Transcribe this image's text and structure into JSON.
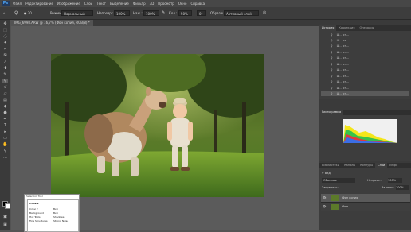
{
  "app": {
    "logo": "Ps"
  },
  "menu": [
    "Файл",
    "Редактирование",
    "Изображение",
    "Слои",
    "Текст",
    "Выделение",
    "Фильтр",
    "3D",
    "Просмотр",
    "Окно",
    "Справка"
  ],
  "options": {
    "mode_label": "Режим:",
    "mode_value": "Нормальный",
    "opacity_label": "Непрозр.:",
    "opacity_value": "100%",
    "flow_label": "Наж.:",
    "flow_value": "100%",
    "strength_label": "Кол.:",
    "strength_value": "50%",
    "angle_value": "0°",
    "sample_label": "Образец:",
    "sample_value": "Активный слой"
  },
  "document": {
    "tab_title": "IMG_6998.ARW @ 16,7% (Фон копия, RGB/8) *"
  },
  "right_panel": {
    "top_tabs": [
      "История",
      "Коррекция",
      "Операции"
    ],
    "history_items": [
      "Ш… ст…",
      "Ш… ст…",
      "Ш… ст…",
      "Ш… ст…",
      "Ш… ст…",
      "Ш… ст…",
      "Ш… ст…",
      "Ш… ст…",
      "Ш… ст…",
      "Ш… ст…",
      "Ш… ст…"
    ],
    "histogram_tab": "Гистограмма",
    "layers_tabs": [
      "Библиотеки",
      "Каналы",
      "Контуры",
      "Слои",
      "Инфо"
    ],
    "layers": {
      "kind_label": "Вид",
      "blend_mode": "Обычные",
      "opacity_label": "Непрозр.:",
      "opacity_value": "100%",
      "lock_label": "Закрепить:",
      "fill_label": "Заливка:",
      "fill_value": "100%",
      "items": [
        {
          "name": "Фон копия",
          "selected": true
        },
        {
          "name": "Фон",
          "selected": false
        }
      ]
    }
  },
  "dialog": {
    "title": "Selection Tool",
    "heading": "Слои 2",
    "rows": [
      {
        "label": "Слои 2",
        "value": "Вкл"
      },
      {
        "label": "Background",
        "value": "Вкл"
      },
      {
        "label": "Hot Tools",
        "value": "Shadows"
      },
      {
        "label": "Fine Structures",
        "value": "Strong Noise"
      }
    ]
  },
  "colors": {
    "accent": "#1473e6",
    "ui_dark": "#3a3a3a",
    "canvas_bg": "#535353"
  }
}
